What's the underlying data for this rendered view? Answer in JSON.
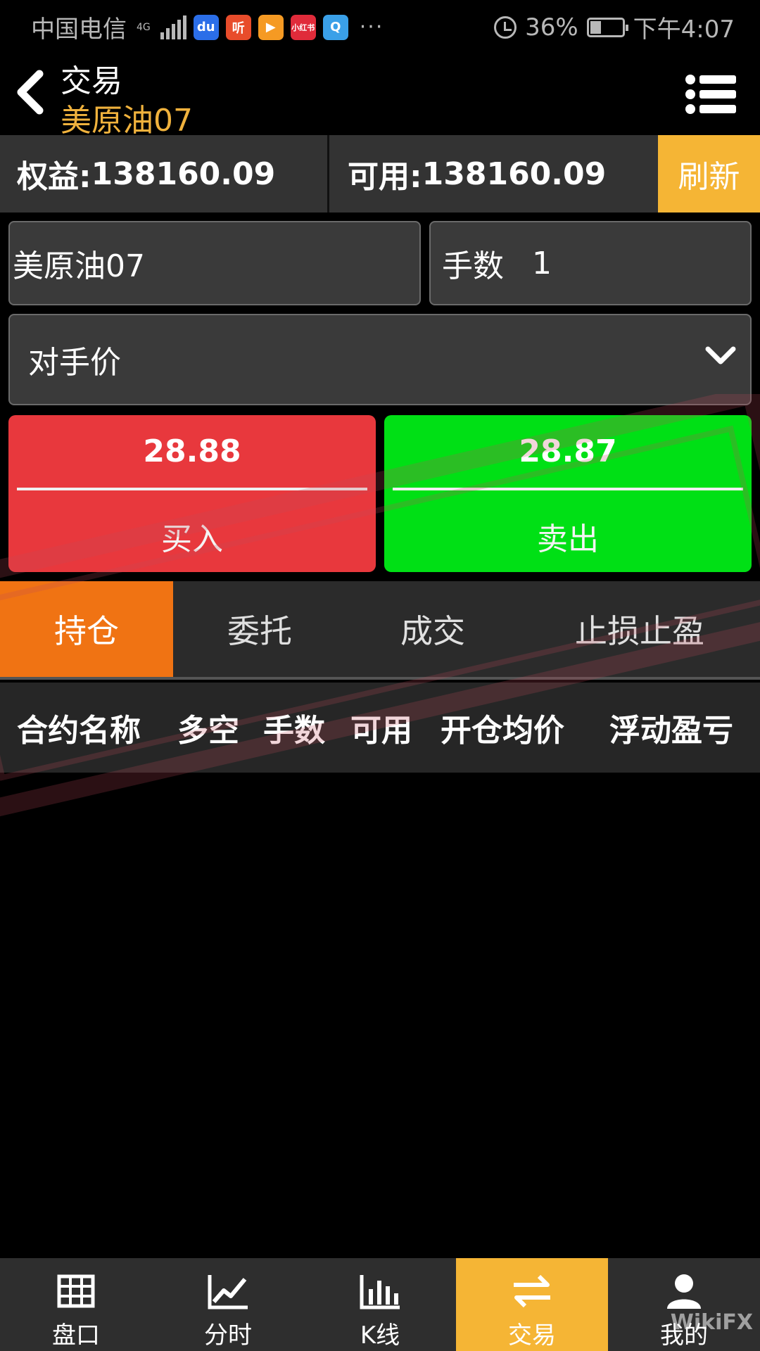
{
  "status_bar": {
    "carrier": "中国电信",
    "network": "4G",
    "apps": [
      "du",
      "听",
      "▶",
      "小红书",
      "Q"
    ],
    "more": "···",
    "battery": "36%",
    "battery_level": 0.36,
    "time": "下午4:07"
  },
  "header": {
    "title": "交易",
    "subtitle": "美原油07",
    "accent_color": "#f0b23d"
  },
  "account": {
    "equity_label": "权益:",
    "equity_value": "138160.09",
    "available_label": "可用:",
    "available_value": "138160.09",
    "refresh_label": "刷新"
  },
  "order": {
    "contract": "美原油07",
    "lots_label": "手数",
    "lots_value": "1",
    "price_type": "对手价"
  },
  "trade": {
    "buy_price": "28.88",
    "buy_label": "买入",
    "buy_color": "#e8383d",
    "sell_price": "28.87",
    "sell_label": "卖出",
    "sell_color": "#00e015"
  },
  "tabs": [
    {
      "label": "持仓",
      "active": true
    },
    {
      "label": "委托",
      "active": false
    },
    {
      "label": "成交",
      "active": false
    },
    {
      "label": "止损止盈",
      "active": false
    }
  ],
  "table_headers": [
    "合约名称",
    "多空",
    "手数",
    "可用",
    "开仓均价",
    "浮动盈亏"
  ],
  "bottom_nav": [
    {
      "label": "盘口",
      "icon": "grid-icon",
      "active": false
    },
    {
      "label": "分时",
      "icon": "line-chart-icon",
      "active": false
    },
    {
      "label": "K线",
      "icon": "bar-chart-icon",
      "active": false
    },
    {
      "label": "交易",
      "icon": "swap-icon",
      "active": true
    },
    {
      "label": "我的",
      "icon": "user-icon",
      "active": false
    }
  ],
  "watermark_text": "WikiFX"
}
